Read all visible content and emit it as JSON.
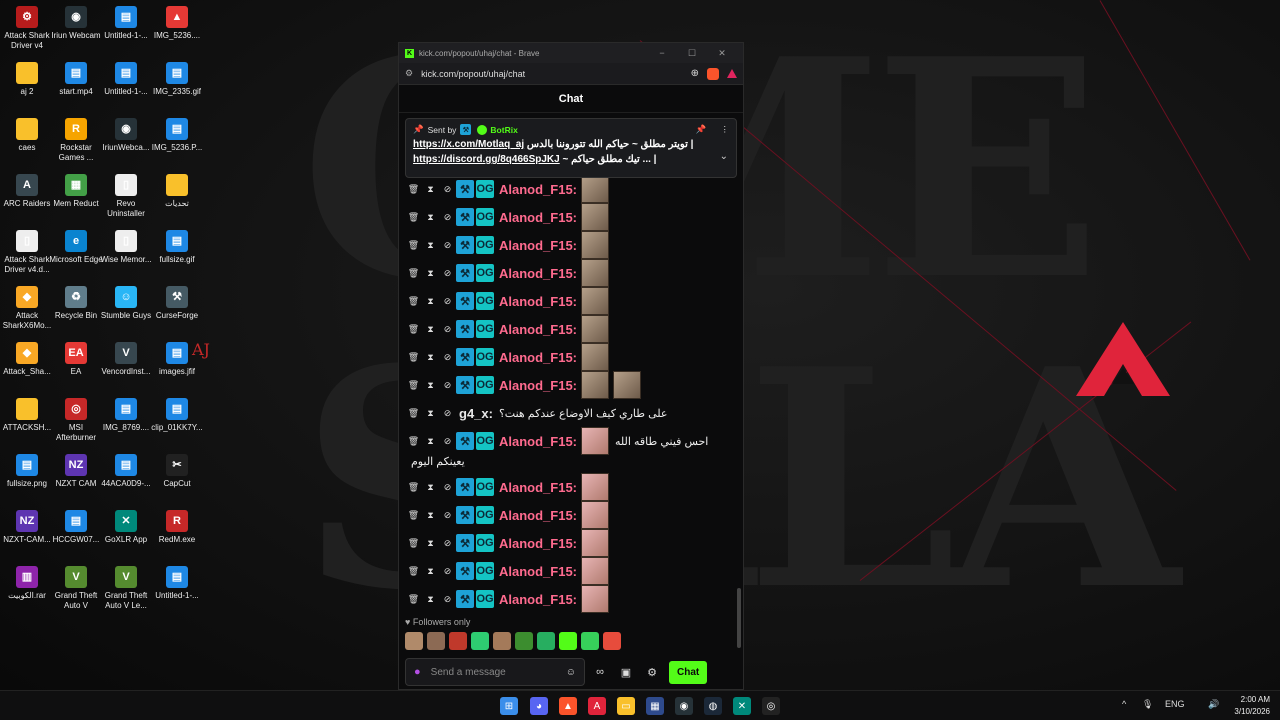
{
  "desktop": {
    "icons": [
      {
        "label": "Attack Shark Driver v4",
        "glyph": "⚙",
        "color": "#b71c1c"
      },
      {
        "label": "Iriun Webcam",
        "glyph": "◉",
        "color": "#263238"
      },
      {
        "label": "Untitled-1-...",
        "glyph": "▤",
        "color": "#1e88e5"
      },
      {
        "label": "IMG_5236....",
        "glyph": "▲",
        "color": "#e53935"
      },
      {
        "label": "aj 2",
        "glyph": "",
        "color": "#f9c02b"
      },
      {
        "label": "start.mp4",
        "glyph": "▤",
        "color": "#1e88e5"
      },
      {
        "label": "Untitled-1-...",
        "glyph": "▤",
        "color": "#1e88e5"
      },
      {
        "label": "IMG_2335.gif",
        "glyph": "▤",
        "color": "#1e88e5"
      },
      {
        "label": "caes",
        "glyph": "",
        "color": "#f9c02b"
      },
      {
        "label": "Rockstar Games ...",
        "glyph": "R",
        "color": "#f6a400"
      },
      {
        "label": "IriunWebca...",
        "glyph": "◉",
        "color": "#263238"
      },
      {
        "label": "IMG_5236.P...",
        "glyph": "▤",
        "color": "#1e88e5"
      },
      {
        "label": "ARC Raiders",
        "glyph": "A",
        "color": "#37474f"
      },
      {
        "label": "Mem Reduct",
        "glyph": "▦",
        "color": "#43a047"
      },
      {
        "label": "Revo Uninstaller",
        "glyph": "▯",
        "color": "#eeeeee"
      },
      {
        "label": "تحديات",
        "glyph": "",
        "color": "#f9c02b"
      },
      {
        "label": "Attack Shark Driver v4.d...",
        "glyph": "▯",
        "color": "#eeeeee"
      },
      {
        "label": "Microsoft Edge",
        "glyph": "e",
        "color": "#0a84d0"
      },
      {
        "label": "Wise Memor...",
        "glyph": "▯",
        "color": "#eeeeee"
      },
      {
        "label": "fullsize.gif",
        "glyph": "▤",
        "color": "#1e88e5"
      },
      {
        "label": "Attack SharkX6Mo...",
        "glyph": "◆",
        "color": "#f9a825"
      },
      {
        "label": "Recycle Bin",
        "glyph": "♻",
        "color": "#607d8b"
      },
      {
        "label": "Stumble Guys",
        "glyph": "☺",
        "color": "#29b6f6"
      },
      {
        "label": "CurseForge",
        "glyph": "⚒",
        "color": "#455a64"
      },
      {
        "label": "Attack_Sha...",
        "glyph": "◆",
        "color": "#f9a825"
      },
      {
        "label": "EA",
        "glyph": "EA",
        "color": "#e53935"
      },
      {
        "label": "VencordInst...",
        "glyph": "V",
        "color": "#37474f"
      },
      {
        "label": "images.jfif",
        "glyph": "▤",
        "color": "#1e88e5"
      },
      {
        "label": "ATTACKSH...",
        "glyph": "",
        "color": "#f9c02b"
      },
      {
        "label": "MSI Afterburner",
        "glyph": "◎",
        "color": "#c62828"
      },
      {
        "label": "IMG_8769....",
        "glyph": "▤",
        "color": "#1e88e5"
      },
      {
        "label": "clip_01KK7Y...",
        "glyph": "▤",
        "color": "#1e88e5"
      },
      {
        "label": "fullsize.png",
        "glyph": "▤",
        "color": "#1e88e5"
      },
      {
        "label": "NZXT CAM",
        "glyph": "NZ",
        "color": "#5e35b1"
      },
      {
        "label": "44ACA0D9-...",
        "glyph": "▤",
        "color": "#1e88e5"
      },
      {
        "label": "CapCut",
        "glyph": "✂",
        "color": "#212121"
      },
      {
        "label": "NZXT-CAM...",
        "glyph": "NZ",
        "color": "#5e35b1"
      },
      {
        "label": "HCCGW07...",
        "glyph": "▤",
        "color": "#1e88e5"
      },
      {
        "label": "GoXLR App",
        "glyph": "✕",
        "color": "#00897b"
      },
      {
        "label": "RedM.exe",
        "glyph": "R",
        "color": "#c62828"
      },
      {
        "label": "الكوبيت.rar",
        "glyph": "▥",
        "color": "#8e24aa"
      },
      {
        "label": "Grand Theft Auto V",
        "glyph": "V",
        "color": "#558b2f"
      },
      {
        "label": "Grand Theft Auto V Le...",
        "glyph": "V",
        "color": "#558b2f"
      },
      {
        "label": "Untitled-1-...",
        "glyph": "▤",
        "color": "#1e88e5"
      }
    ],
    "wallpaper_text": "AJ"
  },
  "browser": {
    "title": "kick.com/popout/uhaj/chat - Brave",
    "url": "kick.com/popout/uhaj/chat",
    "minimize": "−",
    "maximize": "☐",
    "close": "✕"
  },
  "chat": {
    "header": "Chat",
    "pinned": {
      "sent_by_label": "Sent by",
      "bot_name": "BotRix",
      "line1_url": "https://x.com/Motlaq_aj",
      "line1_text": "تويتر مطلق ~ حياكم الله تتوروننا بالدس |",
      "line2_url": "https://discord.gg/8q466SpJKJ",
      "line2_text": "~ تيك مطلق حياكم ... |"
    },
    "messages": [
      {
        "user": "Alanod_F15:",
        "color": "#ff6b8f",
        "emotes": 1,
        "text": ""
      },
      {
        "user": "Alanod_F15:",
        "color": "#ff6b8f",
        "emotes": 1,
        "text": ""
      },
      {
        "user": "Alanod_F15:",
        "color": "#ff6b8f",
        "emotes": 1,
        "text": ""
      },
      {
        "user": "Alanod_F15:",
        "color": "#ff6b8f",
        "emotes": 1,
        "text": ""
      },
      {
        "user": "Alanod_F15:",
        "color": "#ff6b8f",
        "emotes": 1,
        "text": ""
      },
      {
        "user": "Alanod_F15:",
        "color": "#ff6b8f",
        "emotes": 1,
        "text": ""
      },
      {
        "user": "Alanod_F15:",
        "color": "#ff6b8f",
        "emotes": 1,
        "text": ""
      },
      {
        "user": "Alanod_F15:",
        "color": "#ff6b8f",
        "emotes": 2,
        "text": ""
      },
      {
        "user": "g4_x:",
        "color": "#e8e8e8",
        "emotes": 0,
        "text": "على طاري كيف الاوضاع عندكم هنت؟"
      },
      {
        "user": "Alanod_F15:",
        "color": "#ff6b8f",
        "emotes": 1,
        "text": "احس فيني طاقه الله",
        "continuation": "يعينكم اليوم"
      },
      {
        "user": "Alanod_F15:",
        "color": "#ff6b8f",
        "emotes": 1,
        "text": ""
      },
      {
        "user": "Alanod_F15:",
        "color": "#ff6b8f",
        "emotes": 1,
        "text": ""
      },
      {
        "user": "Alanod_F15:",
        "color": "#ff6b8f",
        "emotes": 1,
        "text": ""
      },
      {
        "user": "Alanod_F15:",
        "color": "#ff6b8f",
        "emotes": 1,
        "text": ""
      },
      {
        "user": "Alanod_F15:",
        "color": "#ff6b8f",
        "emotes": 1,
        "text": ""
      }
    ],
    "followers_only": "Followers only",
    "input_placeholder": "Send a message",
    "send_button": "Chat"
  },
  "taskbar": {
    "language": "ENG",
    "time": "2:00 AM",
    "date": "3/10/2026"
  }
}
